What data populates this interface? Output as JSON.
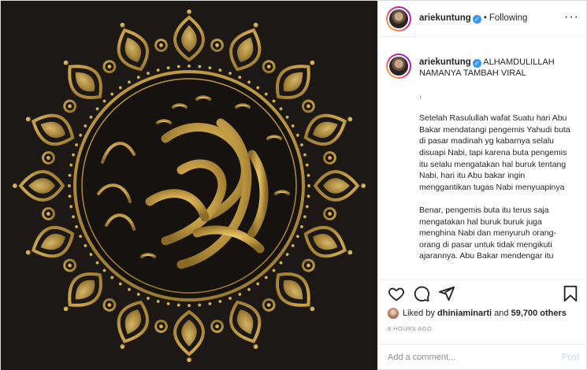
{
  "media": {
    "bg_color": "#1c1816",
    "gold_color": "#c9a24a",
    "calligraphy_icon": "muhammad-calligraphy-icon"
  },
  "header": {
    "username": "ariekuntung",
    "separator": "•",
    "follow_status": "Following",
    "more_icon": "ellipsis-icon",
    "more_glyph": "···"
  },
  "caption": {
    "username": "ariekuntung",
    "headline": "ALHAMDULILLAH NAMANYA TAMBAH VIRAL",
    "body": ".\n\nSetelah Rasulullah wafat Suatu hari Abu Bakar mendatangi pengemis Yahudi buta di pasar madinah yg kabarnya selalu disuapi Nabi, tapi karena buta pengemis itu selalu mengatakan hal buruk tentang Nabi, hari itu Abu bakar ingin menggantikan tugas Nabi menyuapinya\n\nBenar, pengemis buta itu terus saja mengatakan hal buruk buruk juga menghina Nabi dan menyuruh orang-orang di pasar untuk tidak mengikuti ajarannya. Abu Bakar mendengar itu"
  },
  "actions": {
    "like_icon": "heart-icon",
    "comment_icon": "comment-icon",
    "share_icon": "paper-plane-icon",
    "save_icon": "bookmark-icon"
  },
  "likes": {
    "prefix": "Liked by",
    "user": "dhiniaminarti",
    "middle": "and",
    "count": "59,700 others"
  },
  "timestamp": "8 HOURS AGO",
  "comment_box": {
    "placeholder": "Add a comment...",
    "post_label": "Post"
  }
}
